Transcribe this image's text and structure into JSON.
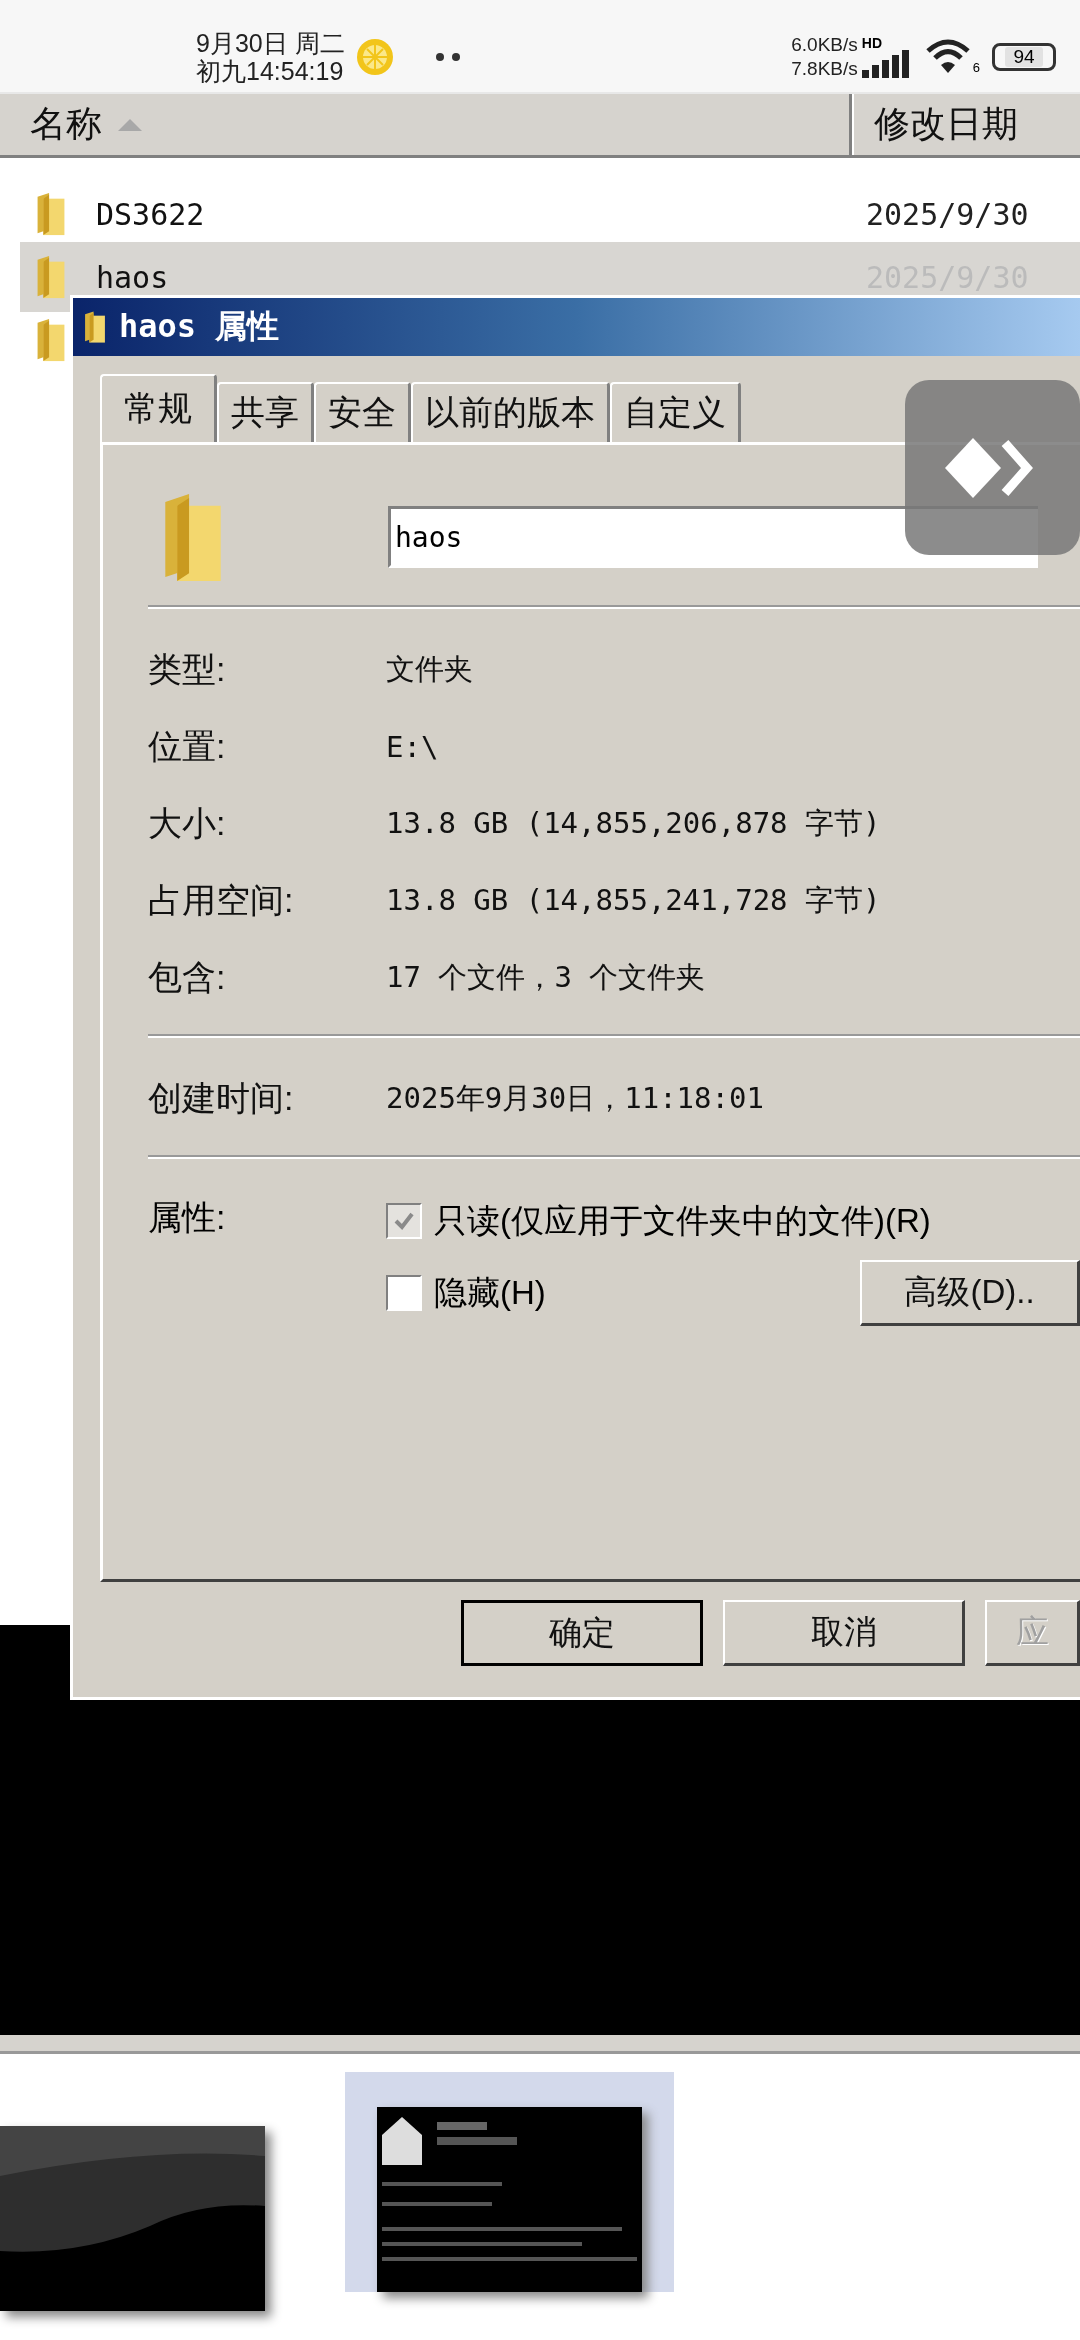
{
  "status_bar": {
    "date": "9月30日 周二",
    "time": "初九14:54:19",
    "upload_speed": "6.0KB/s",
    "download_speed": "7.8KB/s",
    "network": "HD",
    "wifi_standard": "6",
    "battery": "94"
  },
  "file_list": {
    "columns": [
      "名称",
      "修改日期"
    ],
    "rows": [
      {
        "name": "DS3622",
        "modified": "2025/9/30",
        "selected": false
      },
      {
        "name": "haos",
        "modified": "2025/9/30",
        "selected": true
      },
      {
        "selected": false
      }
    ]
  },
  "dialog": {
    "title": "haos 属性",
    "tabs": [
      {
        "label": "常规",
        "selected": true
      },
      {
        "label": "共享",
        "selected": false
      },
      {
        "label": "安全",
        "selected": false
      },
      {
        "label": "以前的版本",
        "selected": false
      },
      {
        "label": "自定义",
        "selected": false
      }
    ],
    "name": "haos",
    "properties": [
      {
        "label": "类型:",
        "value": "文件夹"
      },
      {
        "label": "位置:",
        "value": "E:\\"
      },
      {
        "label": "大小:",
        "value": "13.8 GB (14,855,206,878 字节)"
      },
      {
        "label": "占用空间:",
        "value": "13.8 GB (14,855,241,728 字节)"
      },
      {
        "label": "包含:",
        "value": "17 个文件，3 个文件夹"
      }
    ],
    "created": {
      "label": "创建时间:",
      "value": "2025年9月30日，11:18:01"
    },
    "attributes": {
      "label": "属性:",
      "options": [
        {
          "label": "只读(仅应用于文件夹中的文件)(R)",
          "checked": true,
          "disabled": true
        },
        {
          "label": "隐藏(H)",
          "checked": false,
          "disabled": false
        }
      ],
      "advanced_button": "高级(D).."
    },
    "buttons": [
      {
        "label": "确定",
        "default": true,
        "disabled": false
      },
      {
        "label": "取消",
        "default": false,
        "disabled": false
      },
      {
        "label": "应",
        "default": false,
        "disabled": true
      }
    ]
  },
  "thumbnails": [
    {
      "kind": "picture",
      "selected": false
    },
    {
      "kind": "picture",
      "selected": true
    }
  ]
}
